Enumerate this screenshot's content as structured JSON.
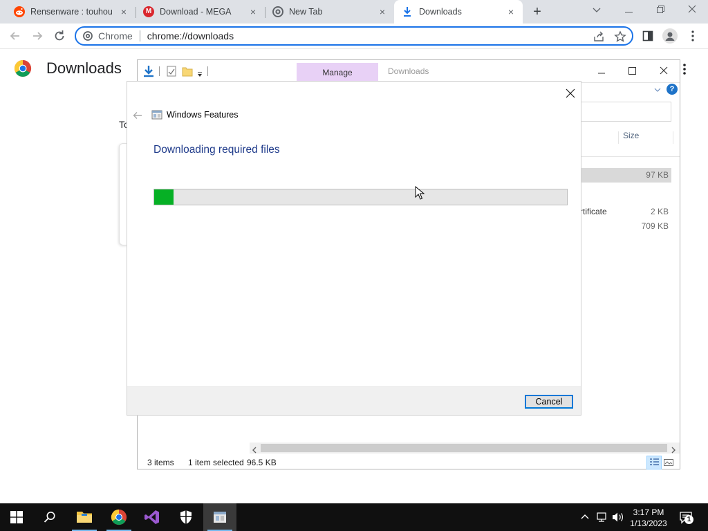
{
  "browser": {
    "tabs": [
      {
        "title": "Rensenware : touhou",
        "icon": "reddit-icon"
      },
      {
        "title": "Download - MEGA",
        "icon": "mega-icon"
      },
      {
        "title": "New Tab",
        "icon": "chrome-icon"
      },
      {
        "title": "Downloads",
        "icon": "download-icon"
      }
    ],
    "active_tab": 3,
    "omnibox": {
      "origin": "Chrome",
      "url": "chrome://downloads"
    }
  },
  "downloads_page": {
    "title": "Downloads",
    "partial_text": "To"
  },
  "explorer": {
    "ribbon_tab": "Manage",
    "caption": "Downloads",
    "column_size": "Size",
    "rows": [
      {
        "name": "",
        "size": "97 KB",
        "selected": true
      },
      {
        "name": "rtificate",
        "size": "2 KB",
        "selected": false
      },
      {
        "name": "",
        "size": "709 KB",
        "selected": false
      }
    ],
    "status": {
      "items": "3 items",
      "selection": "1 item selected",
      "size": "96.5 KB"
    }
  },
  "dialog": {
    "title": "Windows Features",
    "heading": "Downloading required files",
    "progress": 0.047,
    "cancel_label": "Cancel"
  },
  "taskbar": {
    "time": "3:17 PM",
    "date": "1/13/2023",
    "notification_count": "1"
  },
  "colors": {
    "accent": "#1a73e8",
    "progress": "#06b025",
    "heading": "#1e3a8a",
    "manage_tab": "#e8d1f6"
  }
}
